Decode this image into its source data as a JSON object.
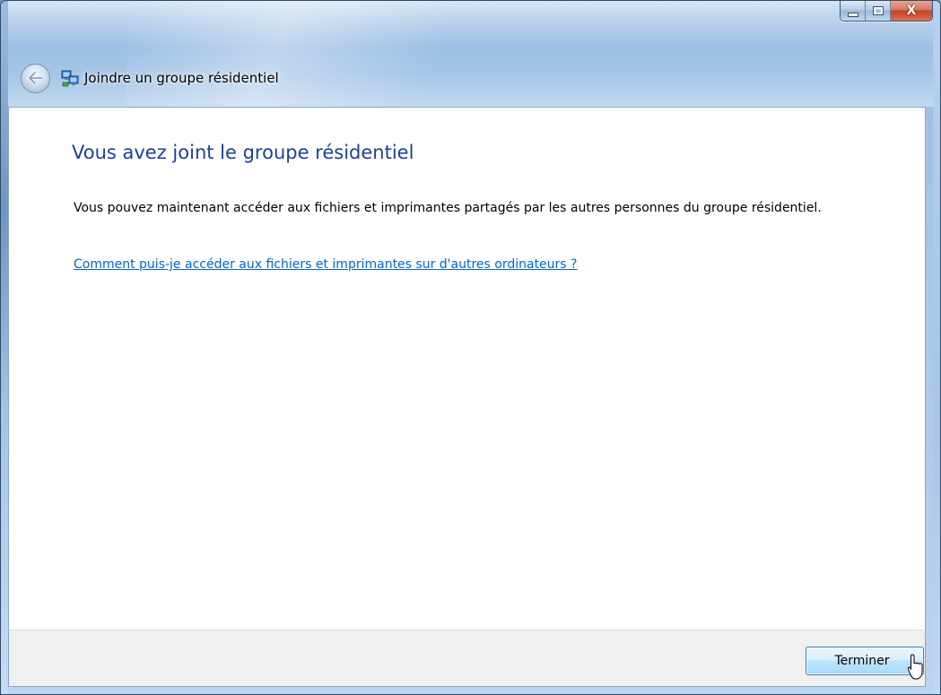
{
  "window": {
    "title": "Joindre un groupe résidentiel",
    "caption_buttons": {
      "minimize_icon": "minimize-icon",
      "maximize_icon": "maximize-icon",
      "close_glyph": "X"
    },
    "back_icon": "back-arrow-icon",
    "title_icon": "homegroup-network-icon"
  },
  "main": {
    "heading": "Vous avez joint le groupe résidentiel",
    "body": "Vous pouvez maintenant accéder aux fichiers et imprimantes partagés par les autres personnes du groupe résidentiel.",
    "help_link": "Comment puis-je accéder aux fichiers et imprimantes sur d'autres ordinateurs ?"
  },
  "footer": {
    "finish_label": "Terminer"
  },
  "colors": {
    "heading": "#1e3f9a",
    "link": "#0066cc",
    "footer_bg": "#f0f0f0"
  }
}
